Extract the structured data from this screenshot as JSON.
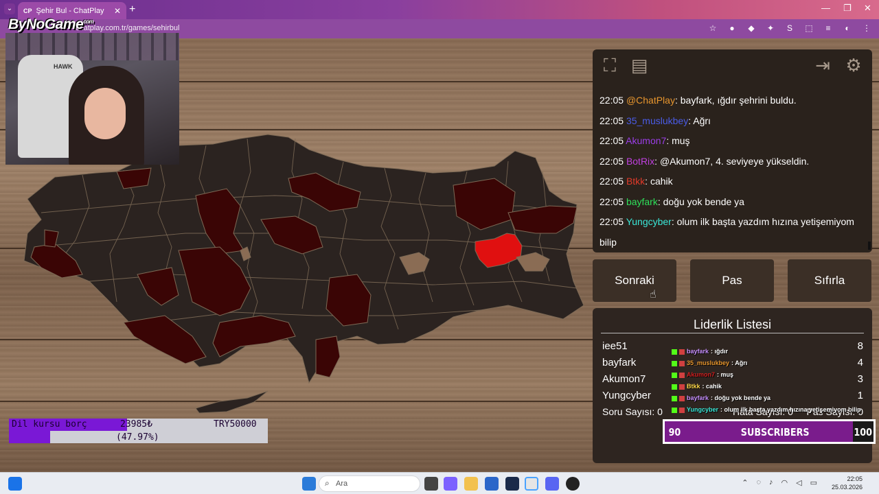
{
  "browser": {
    "tab_title": "Şehir Bul - ChatPlay",
    "tab_icon": "CP",
    "url": "chatplay.com.tr/games/sehirbul",
    "new_tab": "+",
    "close_tab": "✕",
    "minimize": "—",
    "maximize": "❐",
    "close_window": "✕"
  },
  "overlay": {
    "logo_text": "ByNoGame",
    "logo_sup": "com"
  },
  "panel": {
    "icons": [
      "fullscreen-icon",
      "notes-icon",
      "exit-icon",
      "settings-icon"
    ],
    "chat": [
      {
        "time": "22:05",
        "user": "@ChatPlay",
        "color": "#e8962e",
        "text": ": bayfark, ığdır şehrini buldu."
      },
      {
        "time": "22:05",
        "user": "35_muslukbey",
        "color": "#4a5ce8",
        "text": ": Ağrı"
      },
      {
        "time": "22:05",
        "user": "Akumon7",
        "color": "#9b3ee8",
        "text": ": muş"
      },
      {
        "time": "22:05",
        "user": "BotRix",
        "color": "#c040e0",
        "text": ": @Akumon7, 4. seviyeye yükseldin."
      },
      {
        "time": "22:05",
        "user": "Btkk",
        "color": "#e03a2a",
        "text": ": cahik"
      },
      {
        "time": "22:05",
        "user": "bayfark",
        "color": "#2ee05a",
        "text": ": doğu yok bende ya"
      },
      {
        "time": "22:05",
        "user": "Yungcyber",
        "color": "#3ae8d8",
        "text": ": olum ilk başta yazdım hızına yetişemiyom"
      }
    ],
    "chat_continuation": "bilip",
    "buttons": {
      "next": "Sonraki",
      "pass": "Pas",
      "reset": "Sıfırla"
    }
  },
  "leaderboard": {
    "title": "Liderlik Listesi",
    "rows": [
      {
        "name": "iee51",
        "score": "8"
      },
      {
        "name": "bayfark",
        "score": "4"
      },
      {
        "name": "Akumon7",
        "score": "3"
      },
      {
        "name": "Yungcyber",
        "score": "1"
      }
    ],
    "question_count": "Soru Sayısı: 0",
    "error_count": "Hata Sayısı: 0",
    "pass_count": "Pas Sayısı: 0"
  },
  "overlay_chat": [
    {
      "user": "bayfark",
      "color": "#c890ff",
      "text": ": ığdır"
    },
    {
      "user": "35_muslukbey",
      "color": "#e8962e",
      "text": ": Ağrı"
    },
    {
      "user": "Akumon7",
      "color": "#d02020",
      "text": ": muş"
    },
    {
      "user": "Btkk",
      "color": "#ffd84a",
      "text": ": cahik"
    },
    {
      "user": "bayfark",
      "color": "#c890ff",
      "text": ": doğu yok bende ya"
    },
    {
      "user": "Yungcyber",
      "color": "#3ae8d8",
      "text": ": olum ilk başta yazdım hızına yetişemiyom bilip"
    }
  ],
  "donation": {
    "label": "Dil kursu borç",
    "current": "23985₺",
    "goal": "TRY50000",
    "percent_text": "(47.97%)",
    "fraction": 0.4797
  },
  "subscribers": {
    "current": "90",
    "label": "SUBSCRIBERS",
    "goal": "100",
    "fraction": 0.9
  },
  "taskbar": {
    "search_placeholder": "Ara",
    "time": "22:05",
    "date": "25.03.2026"
  },
  "colors": {
    "province_default": "#2b2320",
    "province_found": "#3a0505",
    "province_highlight": "#e01010",
    "province_border": "#7d6a56"
  }
}
